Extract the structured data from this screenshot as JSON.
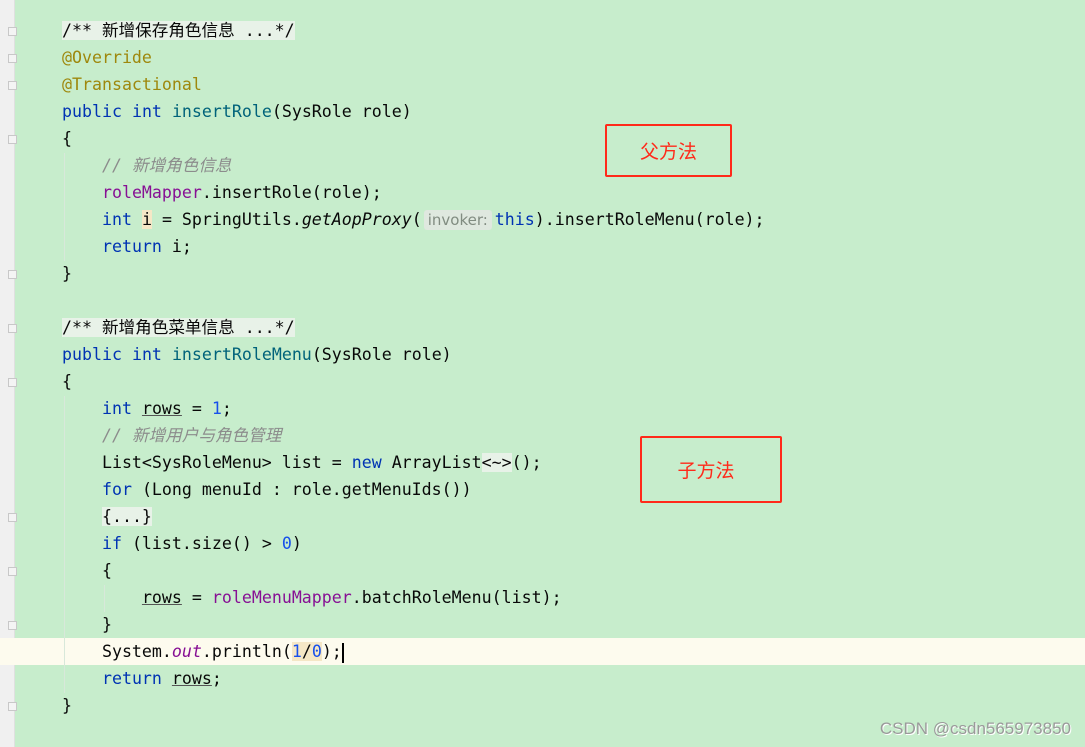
{
  "editor": {
    "lines": [
      {
        "tokens": [
          {
            "t": "/** 新增保存角色信息 ...*/",
            "c": "fd"
          }
        ]
      },
      {
        "tokens": [
          {
            "t": "@Override",
            "c": "an"
          }
        ]
      },
      {
        "tokens": [
          {
            "t": "@Transactional",
            "c": "an"
          }
        ]
      },
      {
        "tokens": [
          {
            "t": "public",
            "c": "kw"
          },
          {
            "t": " "
          },
          {
            "t": "int",
            "c": "kw"
          },
          {
            "t": " "
          },
          {
            "t": "insertRole",
            "c": "fn"
          },
          {
            "t": "(SysRole role)"
          }
        ]
      },
      {
        "tokens": [
          {
            "t": "{"
          }
        ]
      },
      {
        "tokens": [
          {
            "t": "    "
          },
          {
            "t": "// 新增角色信息",
            "c": "cm"
          }
        ]
      },
      {
        "tokens": [
          {
            "t": "    "
          },
          {
            "t": "roleMapper",
            "c": "fld"
          },
          {
            "t": ".insertRole(role);"
          }
        ]
      },
      {
        "tokens": [
          {
            "t": "    "
          },
          {
            "t": "int",
            "c": "kw"
          },
          {
            "t": " "
          },
          {
            "t": "i",
            "c": "hl"
          },
          {
            "t": " = SpringUtils."
          },
          {
            "t": "getAopProxy",
            "c": "st"
          },
          {
            "t": "("
          },
          {
            "t": "invoker:",
            "c": "hint"
          },
          {
            "t": "this",
            "c": "kw"
          },
          {
            "t": ").insertRoleMenu(role);"
          }
        ]
      },
      {
        "tokens": [
          {
            "t": "    "
          },
          {
            "t": "return",
            "c": "kw"
          },
          {
            "t": " i;"
          }
        ]
      },
      {
        "tokens": [
          {
            "t": "}"
          }
        ]
      },
      {
        "tokens": []
      },
      {
        "tokens": [
          {
            "t": "/** 新增角色菜单信息 ...*/",
            "c": "fd"
          }
        ]
      },
      {
        "tokens": [
          {
            "t": "public",
            "c": "kw"
          },
          {
            "t": " "
          },
          {
            "t": "int",
            "c": "kw"
          },
          {
            "t": " "
          },
          {
            "t": "insertRoleMenu",
            "c": "fn"
          },
          {
            "t": "(SysRole role)"
          }
        ]
      },
      {
        "tokens": [
          {
            "t": "{"
          }
        ]
      },
      {
        "tokens": [
          {
            "t": "    "
          },
          {
            "t": "int",
            "c": "kw"
          },
          {
            "t": " "
          },
          {
            "t": "rows",
            "c": "ul"
          },
          {
            "t": " = "
          },
          {
            "t": "1",
            "c": "num"
          },
          {
            "t": ";"
          }
        ]
      },
      {
        "tokens": [
          {
            "t": "    "
          },
          {
            "t": "// 新增用户与角色管理",
            "c": "cm"
          }
        ]
      },
      {
        "tokens": [
          {
            "t": "    List<SysRoleMenu> list = "
          },
          {
            "t": "new",
            "c": "kw"
          },
          {
            "t": " ArrayList"
          },
          {
            "t": "<~>",
            "c": "fd"
          },
          {
            "t": "();"
          }
        ]
      },
      {
        "tokens": [
          {
            "t": "    "
          },
          {
            "t": "for",
            "c": "kw"
          },
          {
            "t": " (Long menuId : role.getMenuIds())"
          }
        ]
      },
      {
        "tokens": [
          {
            "t": "    "
          },
          {
            "t": "{...}",
            "c": "fd"
          }
        ]
      },
      {
        "tokens": [
          {
            "t": "    "
          },
          {
            "t": "if",
            "c": "kw"
          },
          {
            "t": " (list.size() > "
          },
          {
            "t": "0",
            "c": "num"
          },
          {
            "t": ")"
          }
        ]
      },
      {
        "tokens": [
          {
            "t": "    {"
          }
        ]
      },
      {
        "tokens": [
          {
            "t": "        "
          },
          {
            "t": "rows",
            "c": "ul"
          },
          {
            "t": " = "
          },
          {
            "t": "roleMenuMapper",
            "c": "fld"
          },
          {
            "t": ".batchRoleMenu(list);"
          }
        ]
      },
      {
        "tokens": [
          {
            "t": "    }"
          }
        ]
      },
      {
        "current": true,
        "tokens": [
          {
            "t": "    System."
          },
          {
            "t": "out",
            "c": "fld st"
          },
          {
            "t": ".println("
          },
          {
            "t": "1",
            "c": "num hl"
          },
          {
            "t": "/",
            "c": "hl"
          },
          {
            "t": "0",
            "c": "num hl"
          },
          {
            "t": ");"
          },
          {
            "t": "",
            "c": "caret"
          }
        ]
      },
      {
        "tokens": [
          {
            "t": "    "
          },
          {
            "t": "return",
            "c": "kw"
          },
          {
            "t": " "
          },
          {
            "t": "rows",
            "c": "ul"
          },
          {
            "t": ";"
          }
        ]
      },
      {
        "tokens": [
          {
            "t": "}"
          }
        ]
      }
    ]
  },
  "annotations": {
    "parent_label": "父方法",
    "child_label": "子方法",
    "color": "#ff2a1a"
  },
  "watermark": "CSDN @csdn565973850"
}
